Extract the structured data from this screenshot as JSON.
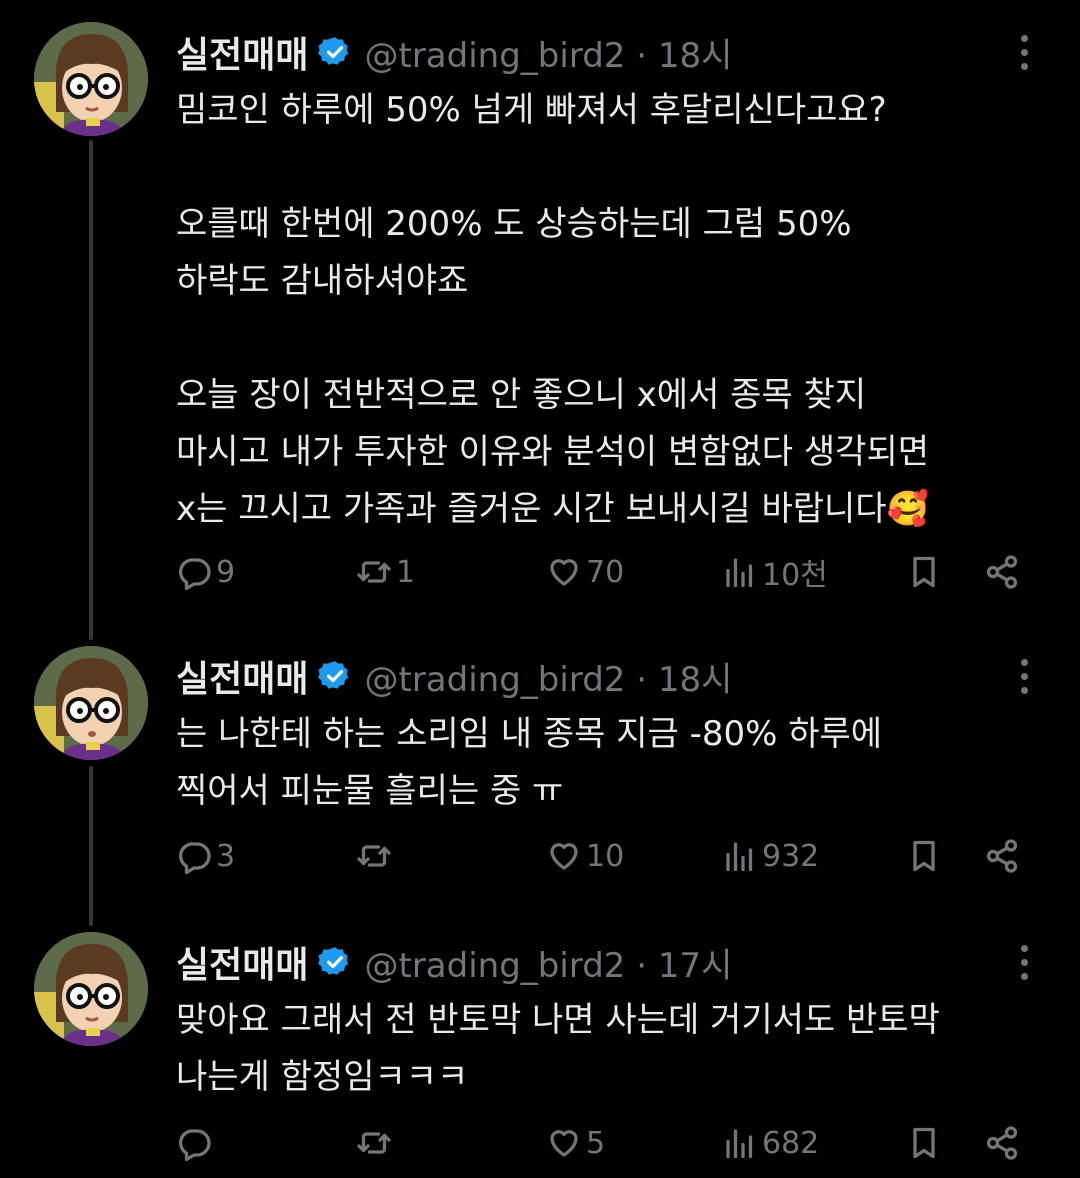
{
  "tweets": [
    {
      "name": "실전매매",
      "handle": "@trading_bird2 · 18시",
      "text": "밈코인 하루에 50% 넘게 빠져서 후달리신다고요?\n\n오를때 한번에 200% 도 상승하는데 그럼 50%\n하락도 감내하셔야죠\n\n오늘 장이 전반적으로 안 좋으니 x에서 종목 찾지\n마시고 내가 투자한 이유와 분석이 변함없다 생각되면\nx는 끄시고 가족과 즐거운 시간 보내시길 바랍니다🥰",
      "replies": "9",
      "reposts": "1",
      "likes": "70",
      "views": "10천"
    },
    {
      "name": "실전매매",
      "handle": "@trading_bird2 · 18시",
      "text": "는 나한테 하는 소리임 내 종목 지금 -80% 하루에\n찍어서 피눈물 흘리는 중 ㅠ",
      "replies": "3",
      "reposts": "",
      "likes": "10",
      "views": "932"
    },
    {
      "name": "실전매매",
      "handle": "@trading_bird2 · 17시",
      "text": "맞아요 그래서 전 반토막 나면 사는데 거기서도 반토막\n나는게 함정임ㅋㅋㅋ",
      "replies": "",
      "reposts": "",
      "likes": "5",
      "views": "682"
    }
  ],
  "icons": {
    "reply": "reply-icon",
    "repost": "repost-icon",
    "like": "like-icon",
    "views": "views-icon",
    "bookmark": "bookmark-icon",
    "share": "share-icon",
    "verified": "verified-badge-icon",
    "more": "more-options-icon"
  },
  "colors": {
    "background": "#000000",
    "text": "#e7e9ea",
    "muted": "#71767b",
    "verified": "#1d9bf0",
    "thread_line": "#333639"
  }
}
